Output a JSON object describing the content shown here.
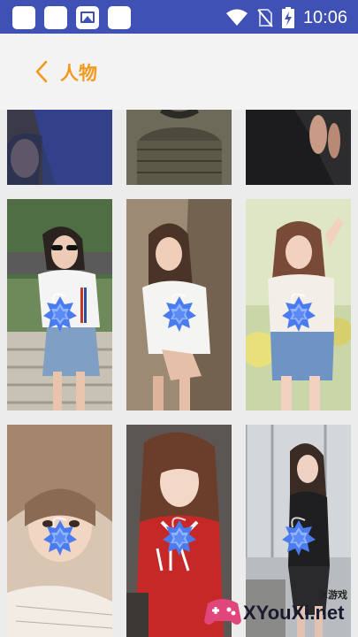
{
  "status_bar": {
    "time": "10:06",
    "icons": [
      "notification-icon",
      "notification-icon",
      "image-icon",
      "notification-icon",
      "wifi-icon",
      "no-sim-icon",
      "battery-charging-icon"
    ]
  },
  "header": {
    "back_icon": "chevron-left-icon",
    "title": "人物"
  },
  "grid": {
    "columns": 3,
    "tiles": [
      {
        "row": 0,
        "col": 0,
        "lock": false
      },
      {
        "row": 0,
        "col": 1,
        "lock": false
      },
      {
        "row": 0,
        "col": 2,
        "lock": false
      },
      {
        "row": 1,
        "col": 0,
        "lock": true
      },
      {
        "row": 1,
        "col": 1,
        "lock": true
      },
      {
        "row": 1,
        "col": 2,
        "lock": true
      },
      {
        "row": 2,
        "col": 0,
        "lock": true
      },
      {
        "row": 2,
        "col": 1,
        "lock": true
      },
      {
        "row": 2,
        "col": 2,
        "lock": true
      }
    ]
  },
  "watermark": {
    "text": "XYouXi.net",
    "sub": "X游戏"
  },
  "colors": {
    "status_bar": "#3f51b5",
    "title": "#f39a1e",
    "lock_badge": "#4a7cf0"
  }
}
